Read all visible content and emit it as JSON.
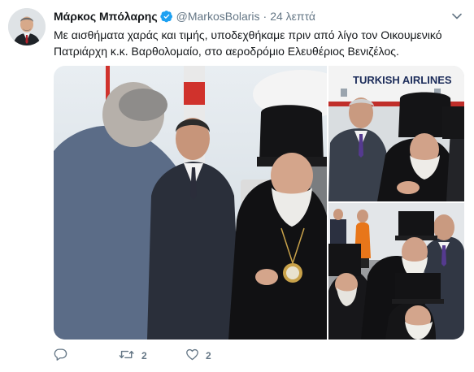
{
  "tweet": {
    "author_name": "Μάρκος Μπόλαρης",
    "handle": "@MarkosBolaris",
    "separator": "·",
    "time": "24 λεπτά",
    "text": "Με αισθήματα χαράς και τιμής, υποδεχθήκαμε πριν από λίγο τον Οικουμενικό Πατριάρχη κ.κ. Βαρθολομαίο, στο αεροδρόμιο Ελευθέριος Βενιζέλος.",
    "verified": true
  },
  "media": {
    "photo_count": 3,
    "airline_sign": "TURKISH AIRLINES"
  },
  "actions": {
    "reply_count": "",
    "retweet_count": "2",
    "like_count": "2"
  },
  "colors": {
    "text": "#14171a",
    "secondary": "#657786",
    "verified": "#1da1f2"
  },
  "icons": {
    "verified": "verified-badge-icon",
    "caret": "chevron-down-icon",
    "reply": "reply-icon",
    "retweet": "retweet-icon",
    "like": "heart-icon"
  }
}
